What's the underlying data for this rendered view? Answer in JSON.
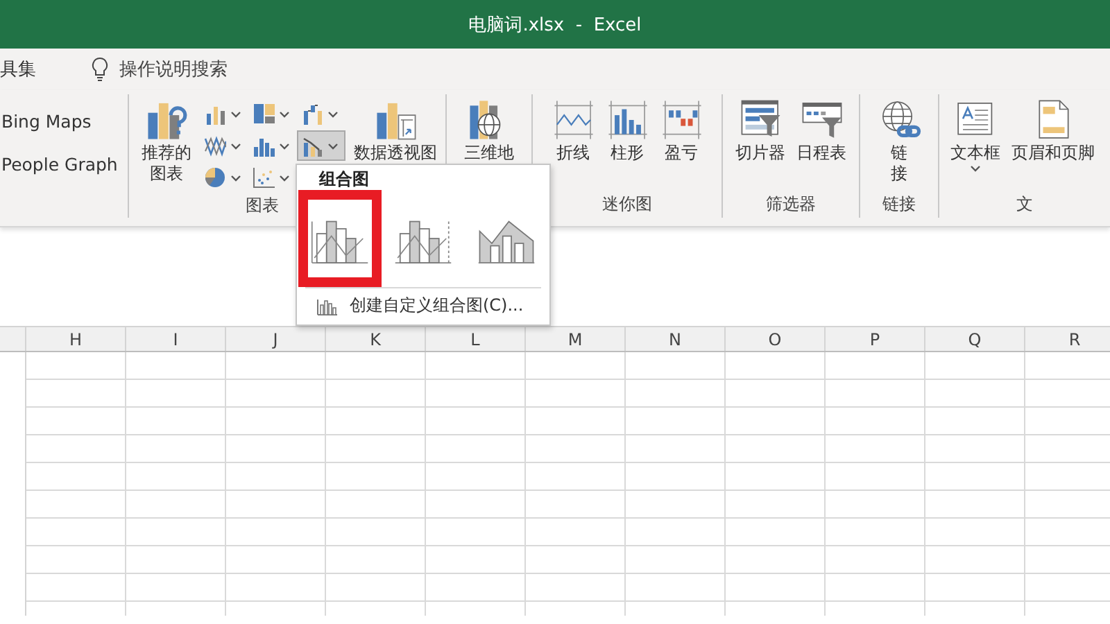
{
  "window": {
    "title": "电脑词.xlsx  -  Excel"
  },
  "tell_me": {
    "tab_text": "具集",
    "search_label": "操作说明搜索"
  },
  "ribbon": {
    "groups": [
      {
        "kind": "addins",
        "items": [
          {
            "label": "Bing Maps"
          },
          {
            "label": "People Graph"
          }
        ]
      },
      {
        "kind": "charts",
        "label": "图表",
        "recommended": "推荐的图表",
        "pivot": "数据透视图",
        "small_buttons": [
          {
            "selected": false
          },
          {
            "selected": false
          },
          {
            "selected": false
          },
          {
            "selected": false
          },
          {
            "selected": false
          },
          {
            "selected": true
          },
          {
            "selected": false
          },
          {
            "selected": false
          }
        ]
      },
      {
        "kind": "buttons",
        "buttons": [
          {
            "kind": "map3d",
            "label": "三维地"
          }
        ]
      },
      {
        "kind": "buttons",
        "label": "迷你图",
        "buttons": [
          {
            "kind": "spark-line",
            "label": "折线"
          },
          {
            "kind": "spark-column",
            "label": "柱形"
          },
          {
            "kind": "win-loss",
            "label": "盈亏"
          }
        ]
      },
      {
        "kind": "buttons",
        "label": "筛选器",
        "buttons": [
          {
            "kind": "slicer",
            "label": "切片器"
          },
          {
            "kind": "timeline",
            "label": "日程表"
          }
        ]
      },
      {
        "kind": "buttons",
        "label": "链接",
        "buttons": [
          {
            "kind": "link",
            "label": "链接"
          }
        ]
      },
      {
        "kind": "buttons",
        "label": "文",
        "buttons": [
          {
            "kind": "textbox",
            "label": "文本框",
            "dropdown": true
          },
          {
            "kind": "header-footer",
            "label": "页眉和页脚"
          }
        ]
      }
    ]
  },
  "dropdown": {
    "header": "组合图",
    "options": [
      {
        "selected": true
      },
      {
        "selected": false
      },
      {
        "selected": false
      }
    ],
    "command": "创建自定义组合图(C)..."
  },
  "sheet": {
    "columns": [
      "H",
      "I",
      "J",
      "K",
      "L",
      "M",
      "N",
      "O",
      "P",
      "Q",
      "R"
    ]
  }
}
